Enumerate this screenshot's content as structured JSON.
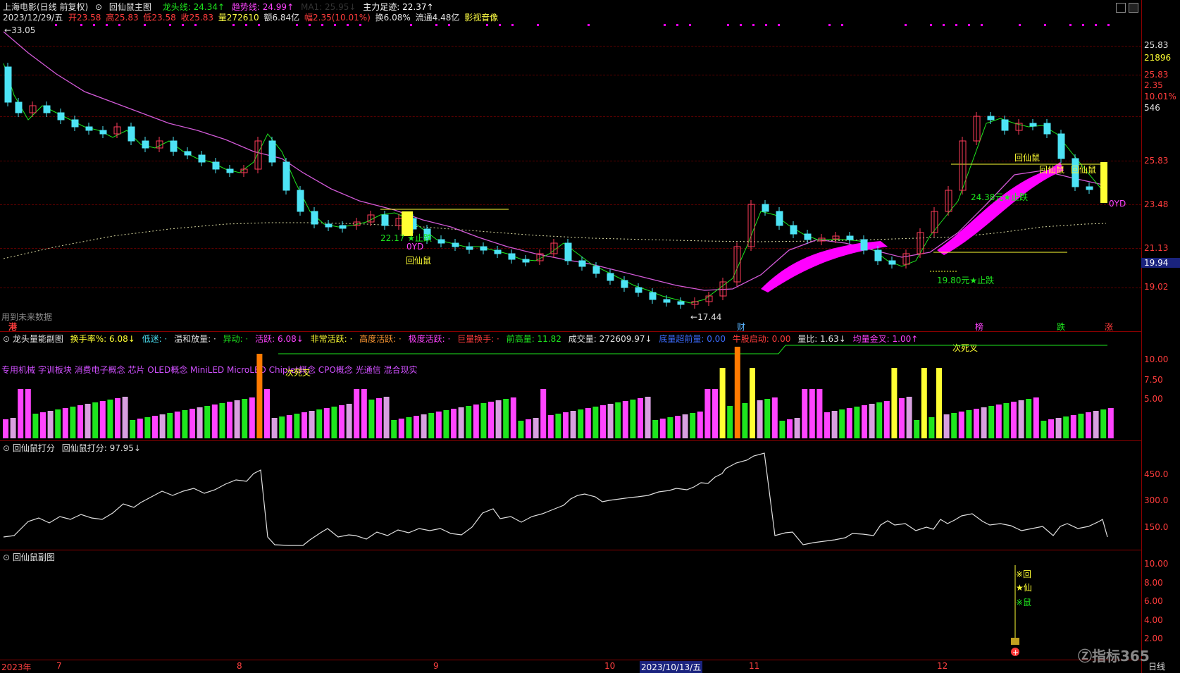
{
  "header": {
    "stock": "上海电影(日线 前复权)",
    "indicator_name": "回仙鼠主图",
    "dragon_line": "龙头线: 24.34↑",
    "trend_line": "趋势线: 24.99↑",
    "ma_faint": "MA1: 25.95↓",
    "main_force": "主力足迹: 22.37↑",
    "date": "2023/12/29/五",
    "open": "开23.58",
    "high": "高25.83",
    "low": "低23.58",
    "close": "收25.83",
    "volume": "量272610",
    "amount": "额6.84亿",
    "change": "幅2.35(10.01%)",
    "turnover": "换6.08%",
    "float": "流通4.48亿",
    "sector": "影视音像"
  },
  "main_chart": {
    "hi_label": "33.05",
    "lo_label": "17.44",
    "future_note": "用到未来数据",
    "ann_1": "22.17",
    "ann_1b": "★止跌",
    "ann_2": "0YD",
    "ann_3": "回仙鼠",
    "ann_4": "24.38元★止跌",
    "ann_5": "19.80元★止跌",
    "ann_6": "回仙鼠",
    "ann_7": "回仙鼠",
    "ann_8": "回仙鼠",
    "ann_9": "0YD",
    "mark_gang": "港",
    "mark_cai": "财",
    "mark_bang": "榜",
    "mark_die": "跌",
    "mark_zhang": "涨",
    "y_labels": [
      "25.83",
      "21896",
      "25.83",
      "2.35",
      "10.01%",
      "546",
      "25.83",
      "23.48",
      "21.13",
      "19.94",
      "19.02"
    ]
  },
  "volume_panel": {
    "title": "龙头量能副图",
    "items": [
      "换手率%: 6.08↓",
      "低迷: ·",
      "温和放量: ·",
      "异动: ·",
      "活跃: 6.08↓",
      "非常活跃: ·",
      "高度活跃: ·",
      "极度活跃: ·",
      "巨量换手: ·",
      "前高量: 11.82",
      "成交量: 272609.97↓",
      "底量超前量: 0.00",
      "牛股启动: 0.00",
      "量比: 1.63↓",
      "均量金叉: 1.00↑"
    ],
    "concepts": "专用机械 字训板块 消费电子概念 芯片 OLED概念 MiniLED MicroLED Chiplet概念 CPO概念 光通信 混合现实",
    "cross_label_1": "次死叉",
    "cross_label_2": "次死叉",
    "y_labels": [
      "10.00",
      "7.50",
      "5.00"
    ]
  },
  "score_panel": {
    "title": "回仙鼠打分",
    "value": "回仙鼠打分: 97.95↓",
    "y_labels": [
      "450.0",
      "300.0",
      "150.0"
    ]
  },
  "sub_panel": {
    "title": "回仙鼠副图",
    "y_labels": [
      "10.00",
      "8.00",
      "6.00",
      "4.00",
      "2.00"
    ],
    "sig_1": "※回",
    "sig_2": "★仙",
    "sig_3": "※鼠"
  },
  "x_axis": {
    "labels": [
      "2023年",
      "7",
      "8",
      "9",
      "10",
      "2023/10/13/五",
      "11",
      "12"
    ],
    "period": "日线",
    "watermark": "指标365"
  },
  "colors": {
    "up": "#ff3c5a",
    "down": "#4de3f5",
    "ma_purple": "#d35ad8",
    "ma_green": "#1ee61e",
    "yellow": "#ffff33",
    "magenta": "#ff00ff"
  }
}
